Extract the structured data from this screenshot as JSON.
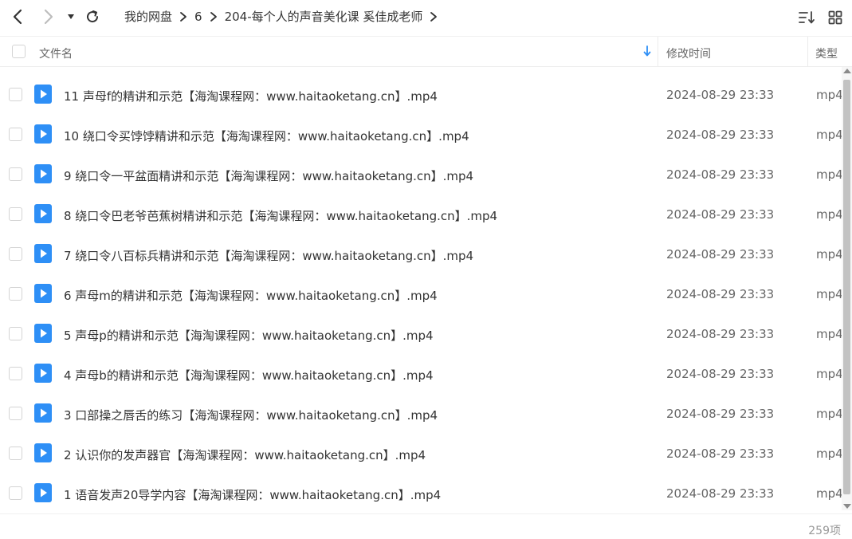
{
  "toolbar": {
    "breadcrumb": [
      "我的网盘",
      "6",
      "204-每个人的声音美化课 奚佳成老师"
    ]
  },
  "header": {
    "name_label": "文件名",
    "mtime_label": "修改时间",
    "type_label": "类型"
  },
  "files": [
    {
      "name": "11 声母f的精讲和示范【海淘课程网：www.haitaoketang.cn】.mp4",
      "time": "2024-08-29 23:33",
      "type": "mp4"
    },
    {
      "name": "10 绕口令买饽饽精讲和示范【海淘课程网：www.haitaoketang.cn】.mp4",
      "time": "2024-08-29 23:33",
      "type": "mp4"
    },
    {
      "name": "9 绕口令一平盆面精讲和示范【海淘课程网：www.haitaoketang.cn】.mp4",
      "time": "2024-08-29 23:33",
      "type": "mp4"
    },
    {
      "name": "8 绕口令巴老爷芭蕉树精讲和示范【海淘课程网：www.haitaoketang.cn】.mp4",
      "time": "2024-08-29 23:33",
      "type": "mp4"
    },
    {
      "name": "7 绕口令八百标兵精讲和示范【海淘课程网：www.haitaoketang.cn】.mp4",
      "time": "2024-08-29 23:33",
      "type": "mp4"
    },
    {
      "name": "6 声母m的精讲和示范【海淘课程网：www.haitaoketang.cn】.mp4",
      "time": "2024-08-29 23:33",
      "type": "mp4"
    },
    {
      "name": "5 声母p的精讲和示范【海淘课程网：www.haitaoketang.cn】.mp4",
      "time": "2024-08-29 23:33",
      "type": "mp4"
    },
    {
      "name": "4 声母b的精讲和示范【海淘课程网：www.haitaoketang.cn】.mp4",
      "time": "2024-08-29 23:33",
      "type": "mp4"
    },
    {
      "name": "3 口部操之唇舌的练习【海淘课程网：www.haitaoketang.cn】.mp4",
      "time": "2024-08-29 23:33",
      "type": "mp4"
    },
    {
      "name": "2 认识你的发声器官【海淘课程网：www.haitaoketang.cn】.mp4",
      "time": "2024-08-29 23:33",
      "type": "mp4"
    },
    {
      "name": "1 语音发声20导学内容【海淘课程网：www.haitaoketang.cn】.mp4",
      "time": "2024-08-29 23:33",
      "type": "mp4"
    }
  ],
  "footer": {
    "count": "259项"
  },
  "colors": {
    "video_icon": "#2e8ff6",
    "sort_arrow": "#2e8ff6",
    "text": "#333333",
    "muted": "#666666"
  },
  "icons": {
    "back": "chevron-left-icon",
    "forward": "chevron-right-icon",
    "history": "caret-down-icon",
    "refresh": "refresh-icon",
    "sort": "sort-list-icon",
    "grid": "grid-view-icon",
    "file": "video-file-icon"
  }
}
